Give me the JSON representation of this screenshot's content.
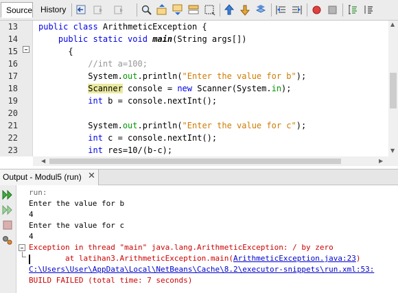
{
  "toolbar": {
    "tabs": [
      {
        "label": "Source",
        "active": true
      },
      {
        "label": "History",
        "active": false
      }
    ],
    "icons": [
      "last-edit-icon",
      "back-icon",
      "forward-icon",
      "find-icon",
      "find-previous-icon",
      "find-next-icon",
      "toggle-highlight-icon",
      "toggle-rect-select-icon",
      "previous-bookmark-icon",
      "next-bookmark-icon",
      "toggle-bookmark-icon",
      "shift-left-icon",
      "shift-right-icon",
      "start-macro-icon",
      "stop-macro-icon",
      "comment-icon",
      "uncomment-icon"
    ]
  },
  "editor": {
    "line_numbers": [
      "13",
      "14",
      "15",
      "16",
      "17",
      "18",
      "19",
      "20",
      "21",
      "22",
      "23"
    ]
  },
  "output": {
    "title": "Output - Modul5 (run)",
    "close": "✕",
    "lines": {
      "run": "run:",
      "prompt_b": "Enter the value for b",
      "val_b": "4",
      "prompt_c": "Enter the value for c",
      "val_c": "4",
      "exception": "Exception in thread \"main\" java.lang.ArithmeticException: / by zero",
      "at_prefix": "        at latihan3.ArithmeticException.main(",
      "at_link": "ArithmeticException.java:23",
      "at_suffix": ")",
      "path": "C:\\Users\\User\\AppData\\Local\\NetBeans\\Cache\\8.2\\executor-snippets\\run.xml:53:",
      "build": "BUILD FAILED (total time: 7 seconds)"
    }
  },
  "colors": {
    "keyword": "#0000e6",
    "string": "#ce7b00",
    "field": "#009900",
    "comment": "#969696",
    "error": "#cc0000",
    "link": "#0000cc"
  }
}
